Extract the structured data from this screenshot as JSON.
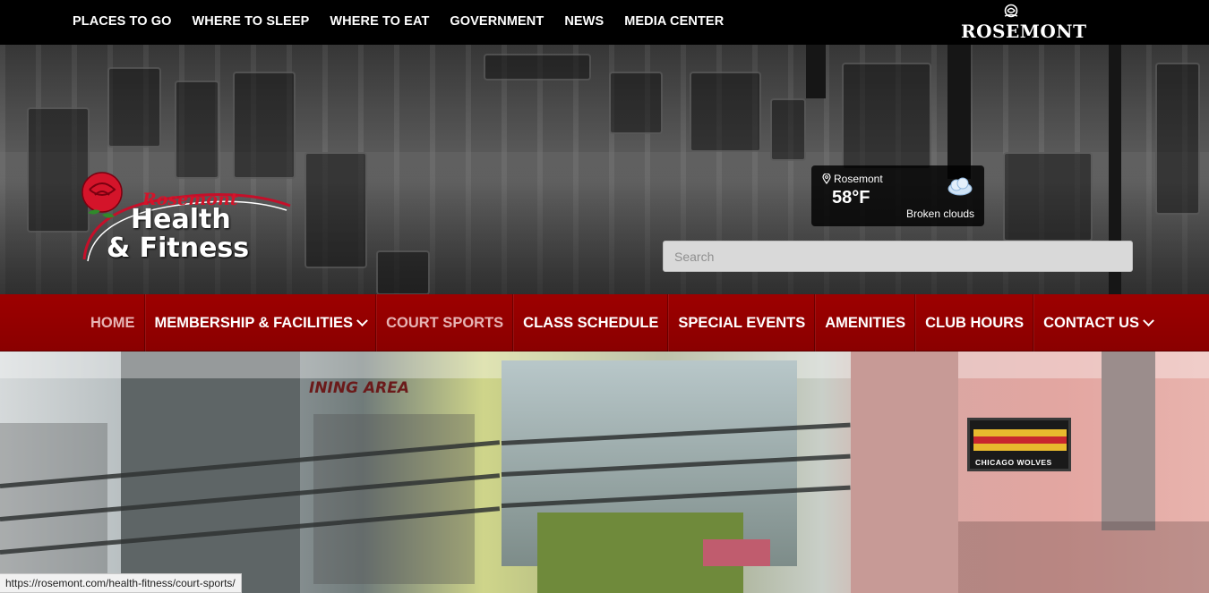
{
  "top_nav": {
    "items": [
      "PLACES TO GO",
      "WHERE TO SLEEP",
      "WHERE TO EAT",
      "GOVERNMENT",
      "NEWS",
      "MEDIA CENTER"
    ],
    "brand": "ROSEMONT"
  },
  "logo": {
    "line1": "Rosemont",
    "line2": "Health",
    "line3": "& Fitness"
  },
  "weather": {
    "location": "Rosemont",
    "temperature": "58°F",
    "description": "Broken clouds",
    "icon": "cloud-icon"
  },
  "search": {
    "placeholder": "Search"
  },
  "main_nav": {
    "items": [
      {
        "label": "HOME",
        "dropdown": false
      },
      {
        "label": "MEMBERSHIP & FACILITIES",
        "dropdown": true
      },
      {
        "label": "COURT SPORTS",
        "dropdown": false
      },
      {
        "label": "CLASS SCHEDULE",
        "dropdown": false
      },
      {
        "label": "SPECIAL EVENTS",
        "dropdown": false
      },
      {
        "label": "AMENITIES",
        "dropdown": false
      },
      {
        "label": "CLUB HOURS",
        "dropdown": false
      },
      {
        "label": "CONTACT US",
        "dropdown": true
      }
    ]
  },
  "slide": {
    "wall_text": "INING AREA",
    "banner_text": "CHICAGO WOLVES"
  },
  "status_bar": {
    "url": "https://rosemont.com/health-fitness/court-sports/"
  },
  "colors": {
    "nav_red": "#9d0000",
    "accent_red": "#d4142a",
    "dim_nav_text": "#e7b4b4"
  }
}
